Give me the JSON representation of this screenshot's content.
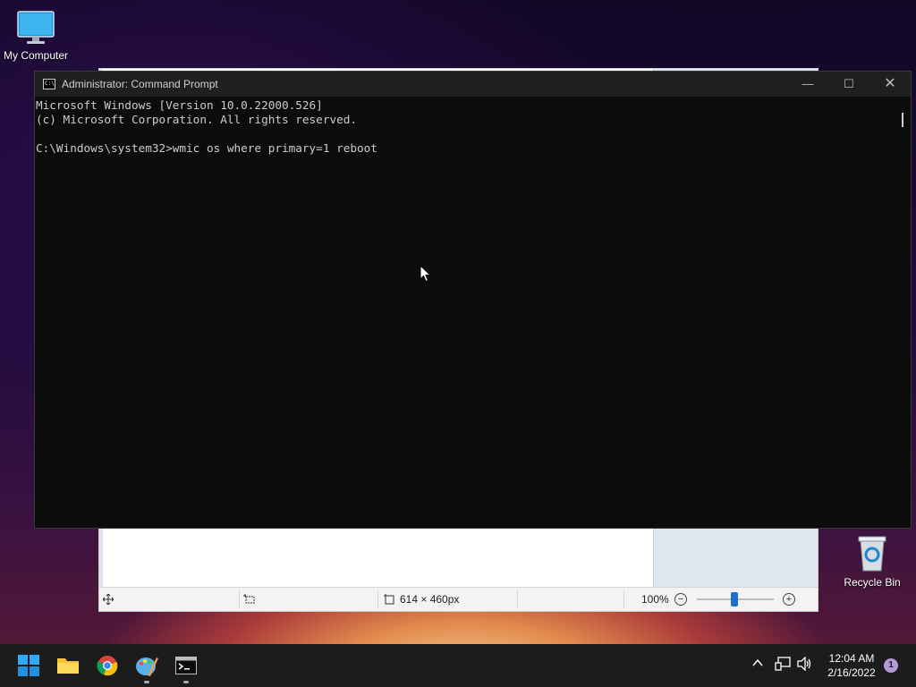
{
  "desktop": {
    "icons": [
      {
        "label": "My Computer"
      },
      {
        "label": "Recycle Bin"
      }
    ]
  },
  "paint": {
    "status": {
      "dimensions": "614 × 460px",
      "zoom": "100%",
      "zoom_level": 1.0
    }
  },
  "cmd": {
    "title": "Administrator: Command Prompt",
    "icon_text": "C:\\",
    "lines": [
      "Microsoft Windows [Version 10.0.22000.526]",
      "(c) Microsoft Corporation. All rights reserved.",
      "",
      "C:\\Windows\\system32>wmic os where primary=1 reboot"
    ]
  },
  "taskbar": {
    "apps": [
      "start-icon",
      "file-explorer-icon",
      "chrome-icon",
      "paint-icon",
      "terminal-icon"
    ],
    "clock": {
      "time": "12:04 AM",
      "date": "2/16/2022"
    },
    "notification_count": "1"
  },
  "colors": {
    "console_bg": "#0c0c0c",
    "console_text": "#cccccc",
    "taskbar_bg": "#1c1c1c",
    "accent": "#1a73c9"
  }
}
